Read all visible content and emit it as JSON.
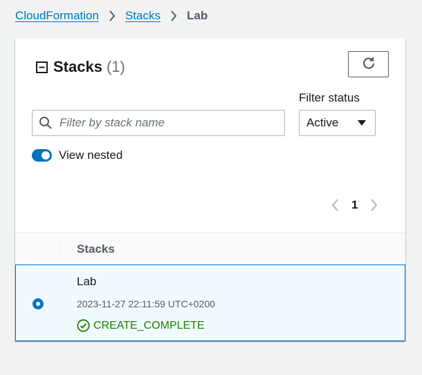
{
  "breadcrumb": {
    "items": [
      {
        "label": "CloudFormation"
      },
      {
        "label": "Stacks"
      }
    ],
    "current": "Lab"
  },
  "panel": {
    "title": "Stacks",
    "count": "(1)"
  },
  "filters": {
    "status_label": "Filter status",
    "search_placeholder": "Filter by stack name",
    "status_value": "Active"
  },
  "toggle": {
    "label": "View nested",
    "on": true
  },
  "pagination": {
    "page": "1"
  },
  "table": {
    "column_header": "Stacks",
    "rows": [
      {
        "name": "Lab",
        "timestamp": "2023-11-27 22:11:59 UTC+0200",
        "status": "CREATE_COMPLETE",
        "selected": true
      }
    ]
  },
  "colors": {
    "link": "#0073bb",
    "success": "#1d8102",
    "selected_bg": "#f1faff",
    "toggle_on": "#0073bb"
  },
  "icons": [
    "chevron-right-icon",
    "collapse-icon",
    "refresh-icon",
    "search-icon",
    "caret-down-icon",
    "chevron-left-icon",
    "check-circle-icon"
  ]
}
